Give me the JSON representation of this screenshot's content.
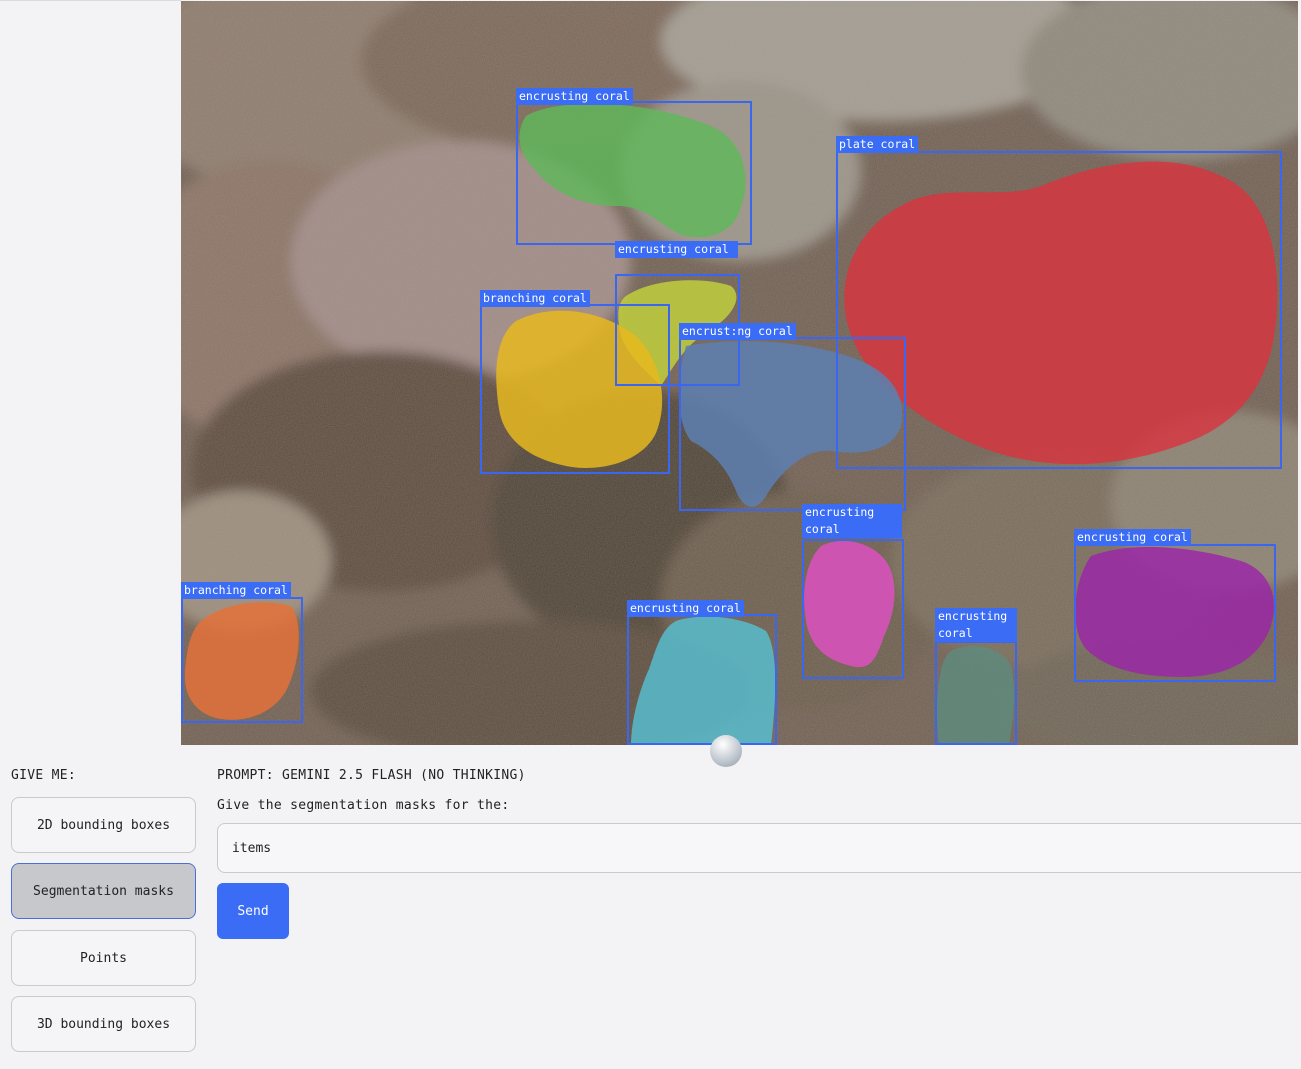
{
  "scene": {
    "colors": {
      "box_stroke": "#3a66f0",
      "label_bg": "#3b6cf6",
      "label_text": "#ffffff",
      "active_button_bg": "#c7c8cc",
      "send_button_bg": "#3b6cf6"
    },
    "detections": [
      {
        "label": "encrusting coral",
        "mask_color": "#5fb85a"
      },
      {
        "label": "plate coral",
        "mask_color": "#d8343f"
      },
      {
        "label": "encrusting coral",
        "mask_color": "#c4d43a"
      },
      {
        "label": "branching coral",
        "mask_color": "#e6b81e"
      },
      {
        "label": "encrust:ng coral",
        "mask_color": "#5d7fb2"
      },
      {
        "label": "encrusting coral",
        "mask_color": "#e24fc6"
      },
      {
        "label": "encrusting coral",
        "mask_color": "#9c24a8"
      },
      {
        "label": "branching coral",
        "mask_color": "#e4713a"
      },
      {
        "label": "encrusting coral",
        "mask_color": "#57c0d2"
      },
      {
        "label": "encrusting coral",
        "mask_color": "#5c8c7e"
      }
    ]
  },
  "controls": {
    "give_me_label": "GIVE ME:",
    "modes": [
      {
        "label": "2D bounding boxes",
        "active": false
      },
      {
        "label": "Segmentation masks",
        "active": true
      },
      {
        "label": "Points",
        "active": false
      },
      {
        "label": "3D bounding boxes",
        "active": false
      }
    ]
  },
  "prompt": {
    "title": "PROMPT: GEMINI 2.5 FLASH (NO THINKING)",
    "instruction": "Give the segmentation masks for the:",
    "input_value": "items",
    "send_label": "Send"
  }
}
